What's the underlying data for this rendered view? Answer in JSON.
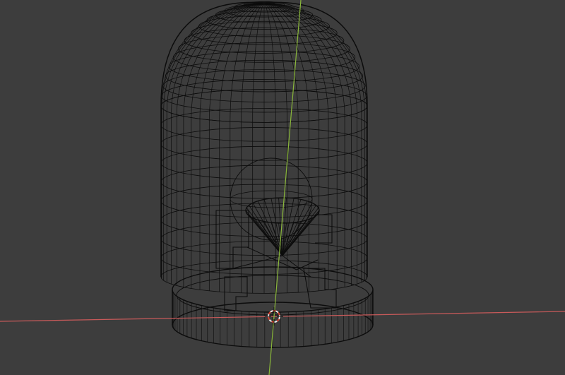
{
  "viewport": {
    "mode": "wireframe",
    "background_color": "#3d3d3d",
    "wire_color": "#0c0c0c",
    "axis_x_color": "#c85a5a",
    "axis_y_color": "#8ab83a",
    "cursor_colors": [
      "#e8e8e8",
      "#d2402f"
    ]
  },
  "scene": {
    "object": "led-bulb-wireframe",
    "parts": [
      "dome-cap",
      "cylinder-body",
      "base-ring",
      "inner-lens",
      "emitter-cone",
      "lead-frame"
    ],
    "icons": [
      "3d-cursor-icon"
    ]
  }
}
